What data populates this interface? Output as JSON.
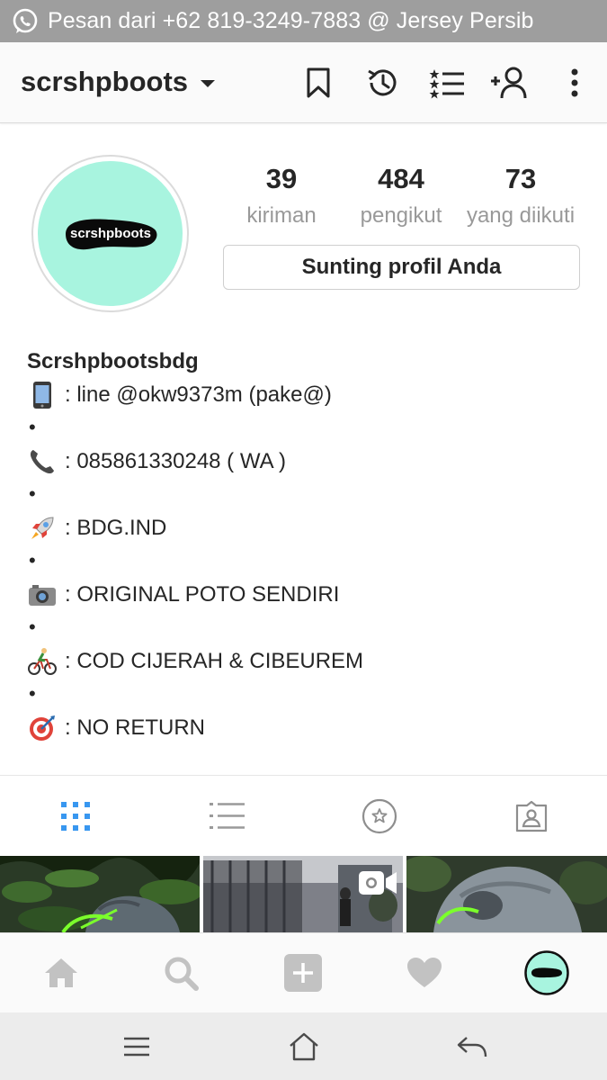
{
  "notification": {
    "icon": "whatsapp-icon",
    "text": "Pesan dari +62 819-3249-7883 @ Jersey Persib",
    "bg": "#9e9e9e"
  },
  "appbar": {
    "username": "scrshpboots",
    "icons": [
      "bookmark-icon",
      "history-icon",
      "close-friends-list-icon",
      "add-person-icon",
      "more-icon"
    ]
  },
  "profile": {
    "avatar_text": "scrshpboots",
    "avatar_bg": "#a8f4df",
    "stats": [
      {
        "value": "39",
        "label": "kiriman"
      },
      {
        "value": "484",
        "label": "pengikut"
      },
      {
        "value": "73",
        "label": "yang diikuti"
      }
    ],
    "edit_button": "Sunting profil Anda"
  },
  "bio": {
    "name": "Scrshpbootsbdg",
    "lines": [
      {
        "icon": "mobile-phone-icon",
        "text": ": line @okw9373m (pake@)"
      },
      {
        "icon": "telephone-icon",
        "text": ": 085861330248 ( WA )"
      },
      {
        "icon": "rocket-icon",
        "text": ": BDG.IND"
      },
      {
        "icon": "camera-icon",
        "text": ": ORIGINAL POTO SENDIRI"
      },
      {
        "icon": "cyclist-icon",
        "text": ": COD CIJERAH & CIBEUREM"
      },
      {
        "icon": "target-icon",
        "text": ": NO RETURN"
      }
    ],
    "separator": "•"
  },
  "tabs": [
    "grid-icon",
    "list-icon",
    "saved-star-icon",
    "tagged-icon"
  ],
  "active_tab_color": "#3897f0",
  "grid": [
    {
      "type": "photo",
      "desc": "shoe-on-plants"
    },
    {
      "type": "video",
      "icon": "video-icon"
    },
    {
      "type": "photo",
      "desc": "shoe-closeup"
    }
  ],
  "bottom_nav": [
    "home-icon",
    "search-icon",
    "add-post-icon",
    "heart-icon",
    "profile-avatar"
  ],
  "system_nav": [
    "menu-icon",
    "home-outline-icon",
    "back-icon"
  ]
}
